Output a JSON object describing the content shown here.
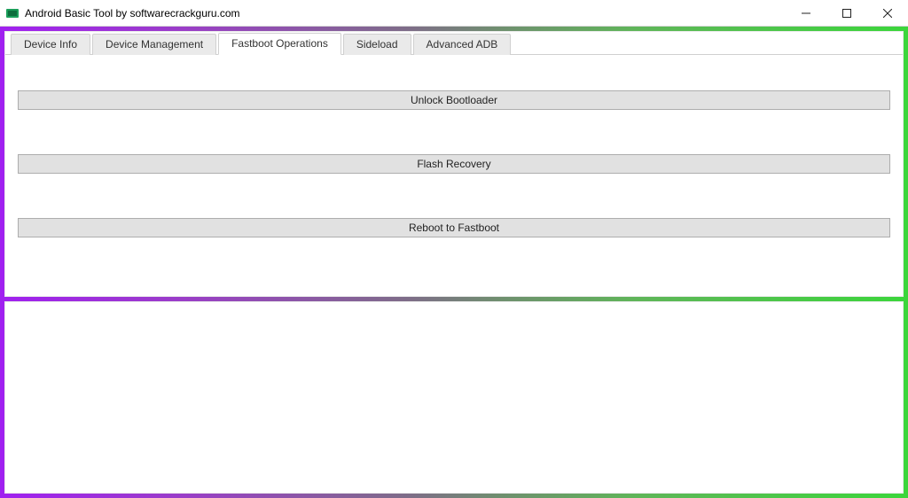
{
  "window": {
    "title": "Android Basic Tool by softwarecrackguru.com"
  },
  "tabs": [
    {
      "label": "Device Info",
      "active": false
    },
    {
      "label": "Device Management",
      "active": false
    },
    {
      "label": "Fastboot Operations",
      "active": true
    },
    {
      "label": "Sideload",
      "active": false
    },
    {
      "label": "Advanced ADB",
      "active": false
    }
  ],
  "fastboot": {
    "buttons": {
      "unlock_bootloader": "Unlock Bootloader",
      "flash_recovery": "Flash Recovery",
      "reboot_fastboot": "Reboot to Fastboot"
    }
  }
}
